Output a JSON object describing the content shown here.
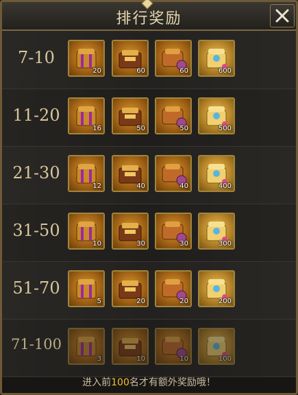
{
  "header": {
    "title": "排行奖励"
  },
  "rows": [
    {
      "range": "7-10",
      "counts": [
        "20",
        "60",
        "60",
        "600"
      ]
    },
    {
      "range": "11-20",
      "counts": [
        "16",
        "50",
        "50",
        "500"
      ]
    },
    {
      "range": "21-30",
      "counts": [
        "12",
        "40",
        "40",
        "400"
      ]
    },
    {
      "range": "31-50",
      "counts": [
        "10",
        "30",
        "30",
        "300"
      ]
    },
    {
      "range": "51-70",
      "counts": [
        "5",
        "20",
        "20",
        "200"
      ]
    },
    {
      "range": "71-100",
      "counts": [
        "3",
        "10",
        "10",
        "100"
      ]
    }
  ],
  "item_icons": [
    "purple-ribbon-chest-icon",
    "gold-bars-chest-icon",
    "round-chest-icon",
    "jewel-chest-icon"
  ],
  "footer": {
    "prefix": "进入前",
    "highlight": "100",
    "suffix": "名才有额外奖励哦！"
  },
  "colors": {
    "accent": "#f2c230",
    "title": "#e7d8b0",
    "range": "#d8c79c",
    "frame": "#a0863e"
  }
}
